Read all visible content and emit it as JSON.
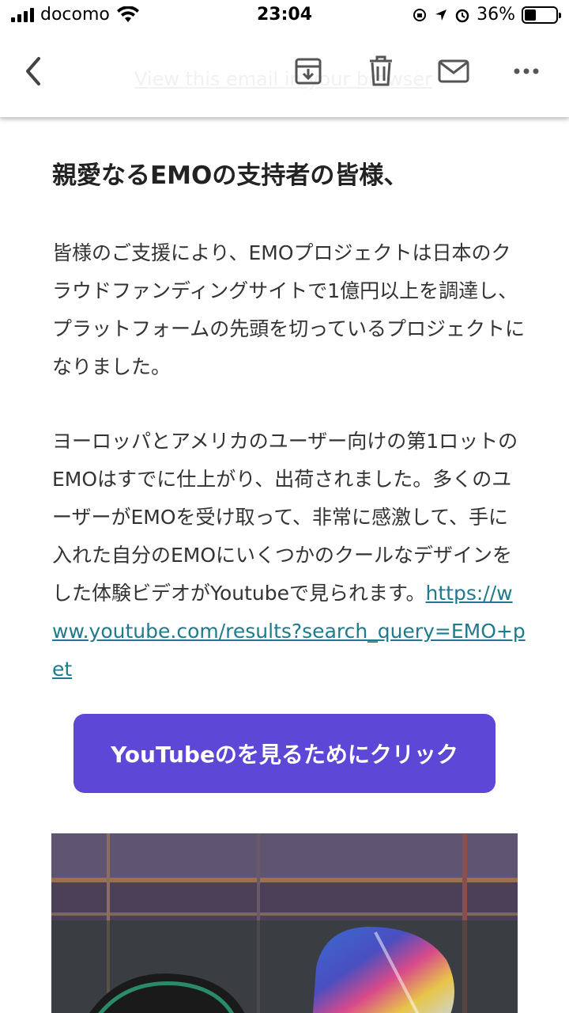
{
  "status_bar": {
    "carrier": "docomo",
    "time": "23:04",
    "battery": "36%"
  },
  "toolbar": {
    "browser_link": "View this email in your browser"
  },
  "email": {
    "greeting": "親愛なるEMOの支持者の皆様、",
    "para1": "皆様のご支援により、EMOプロジェクトは日本のクラウドファンディングサイトで1億円以上を調達し、プラットフォームの先頭を切っているプロジェクトになりました。",
    "para2_text": "ヨーロッパとアメリカのユーザー向けの第1ロットのEMOはすでに仕上がり、出荷されました。多くのユーザーがEMOを受け取って、非常に感激して、手に入れた自分のEMOにいくつかのクールなデザインをした体験ビデオがYoutubeで見られます。",
    "youtube_link": "https://www.youtube.com/results?search_query=EMO+pet",
    "cta_label": "YouTubeのを見るためにクリック"
  },
  "colors": {
    "accent": "#5c47d6",
    "link": "#1f7a8c"
  },
  "icons": [
    "back-chevron-icon",
    "archive-icon",
    "trash-icon",
    "mail-icon",
    "more-icon"
  ]
}
